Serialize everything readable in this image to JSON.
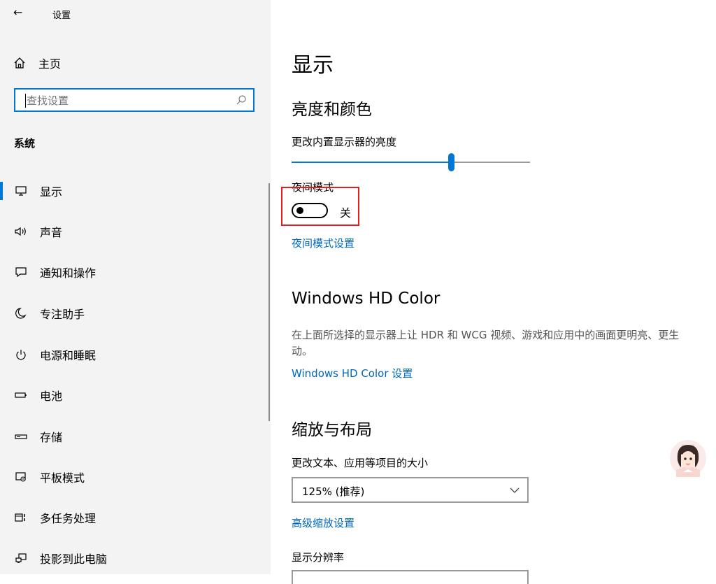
{
  "window": {
    "title": "设置"
  },
  "sidebar": {
    "home_label": "主页",
    "search": {
      "placeholder": "查找设置",
      "value": ""
    },
    "section_title": "系统",
    "items": [
      {
        "label": "显示",
        "icon": "monitor-icon",
        "active": true
      },
      {
        "label": "声音",
        "icon": "speaker-icon"
      },
      {
        "label": "通知和操作",
        "icon": "notification-icon"
      },
      {
        "label": "专注助手",
        "icon": "moon-icon"
      },
      {
        "label": "电源和睡眠",
        "icon": "power-icon"
      },
      {
        "label": "电池",
        "icon": "battery-icon"
      },
      {
        "label": "存储",
        "icon": "storage-icon"
      },
      {
        "label": "平板模式",
        "icon": "tablet-mode-icon"
      },
      {
        "label": "多任务处理",
        "icon": "multitasking-icon"
      },
      {
        "label": "投影到此电脑",
        "icon": "projection-icon"
      }
    ]
  },
  "main": {
    "title": "显示",
    "brightness_section": {
      "heading": "亮度和颜色",
      "slider_label": "更改内置显示器的亮度",
      "brightness_value": 0.67
    },
    "night_light": {
      "label": "夜间模式",
      "state": "关",
      "on": false,
      "settings_link": "夜间模式设置"
    },
    "hdr": {
      "heading": "Windows HD Color",
      "description": "在上面所选择的显示器上让 HDR 和 WCG 视频、游戏和应用中的画面更明亮、更生动。",
      "link": "Windows HD Color 设置"
    },
    "scale": {
      "heading": "缩放与布局",
      "label": "更改文本、应用等项目的大小",
      "selected": "125% (推荐)",
      "advanced_link": "高级缩放设置",
      "resolution_label": "显示分辨率"
    }
  },
  "colors": {
    "accent": "#0078d7",
    "link": "#0067c0",
    "highlight": "#e02020",
    "sidebar_bg": "#f3f3f3"
  }
}
